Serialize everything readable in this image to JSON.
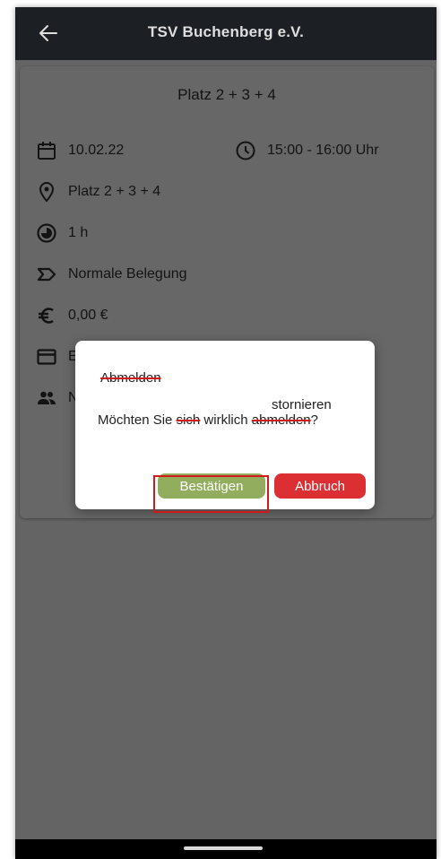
{
  "appbar": {
    "title": "TSV Buchenberg e.V.",
    "back_icon": "arrow-left-icon"
  },
  "details": {
    "title": "Platz 2 + 3 + 4",
    "date": "10.02.22",
    "time": "15:00 - 16:00 Uhr",
    "location": "Platz 2 + 3 + 4",
    "duration": "1 h",
    "type": "Normale Belegung",
    "price": "0,00 €",
    "payment_partial": "E",
    "members_partial": "N"
  },
  "dialog": {
    "title": "Abmelden",
    "message_prefix": "Möchten Sie",
    "message_strike_1": "sich",
    "message_middle": "wirklich",
    "message_strike_2": "abmelden",
    "message_suffix": "?",
    "annotation": "stornieren",
    "confirm_label": "Bestätigen",
    "cancel_label": "Abbruch"
  },
  "colors": {
    "appbar": "#1e2126",
    "scrim_background": "#6b6b6b",
    "confirm": "#93ad5f",
    "cancel": "#dc2f34",
    "annotation_red": "#d11a1a"
  }
}
